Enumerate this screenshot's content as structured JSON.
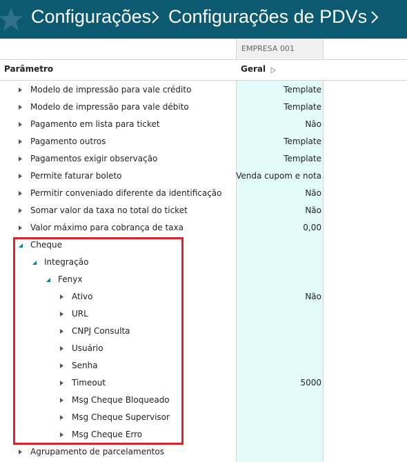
{
  "header": {
    "crumb1": "Configurações",
    "crumb2": "Configurações de PDVs",
    "background": "#0b5a71"
  },
  "columns": {
    "empresa": "EMPRESA 001",
    "parametro": "Parâmetro",
    "geral": "Geral"
  },
  "rows": [
    {
      "label": "Modelo de impressão para vale crédito",
      "value": "Template",
      "level": 0,
      "expander": "collapsed"
    },
    {
      "label": "Modelo de impressão para vale débito",
      "value": "Template",
      "level": 0,
      "expander": "collapsed"
    },
    {
      "label": "Pagamento em lista para ticket",
      "value": "Não",
      "level": 0,
      "expander": "collapsed"
    },
    {
      "label": "Pagamento outros",
      "value": "Template",
      "level": 0,
      "expander": "collapsed"
    },
    {
      "label": "Pagamentos exigir observação",
      "value": "Template",
      "level": 0,
      "expander": "collapsed"
    },
    {
      "label": "Permite faturar boleto",
      "value": "Venda cupom e nota",
      "level": 0,
      "expander": "collapsed"
    },
    {
      "label": "Permitir conveniado diferente da identificação",
      "value": "Não",
      "level": 0,
      "expander": "collapsed"
    },
    {
      "label": "Somar valor da taxa no total do ticket",
      "value": "Não",
      "level": 0,
      "expander": "collapsed"
    },
    {
      "label": "Valor máximo para cobrança de taxa",
      "value": "0,00",
      "level": 0,
      "expander": "collapsed"
    },
    {
      "label": "Cheque",
      "value": "",
      "level": 0,
      "expander": "expanded"
    },
    {
      "label": "Integração",
      "value": "",
      "level": 1,
      "expander": "expanded"
    },
    {
      "label": "Fenyx",
      "value": "",
      "level": 2,
      "expander": "expanded"
    },
    {
      "label": "Ativo",
      "value": "Não",
      "level": 3,
      "expander": "collapsed"
    },
    {
      "label": "URL",
      "value": "",
      "level": 3,
      "expander": "collapsed"
    },
    {
      "label": "CNPJ Consulta",
      "value": "",
      "level": 3,
      "expander": "collapsed"
    },
    {
      "label": "Usuário",
      "value": "",
      "level": 3,
      "expander": "collapsed"
    },
    {
      "label": "Senha",
      "value": "",
      "level": 3,
      "expander": "collapsed"
    },
    {
      "label": "Timeout",
      "value": "5000",
      "level": 3,
      "expander": "collapsed"
    },
    {
      "label": "Msg Cheque Bloqueado",
      "value": "",
      "level": 3,
      "expander": "collapsed"
    },
    {
      "label": "Msg Cheque Supervisor",
      "value": "",
      "level": 3,
      "expander": "collapsed"
    },
    {
      "label": "Msg Cheque Erro",
      "value": "",
      "level": 3,
      "expander": "collapsed"
    },
    {
      "label": "Agrupamento de parcelamentos",
      "value": "",
      "level": 0,
      "expander": "collapsed"
    }
  ],
  "icons": {
    "star": "star-icon",
    "separator": "chevron-right-icon",
    "sort": "sort-arrow-icon",
    "collapsed": "triangle-right-icon",
    "expanded": "triangle-down-icon"
  },
  "colors": {
    "value_column": "#e3fafb",
    "highlight": "#e0202a",
    "expanded_icon": "#0b7d93"
  }
}
